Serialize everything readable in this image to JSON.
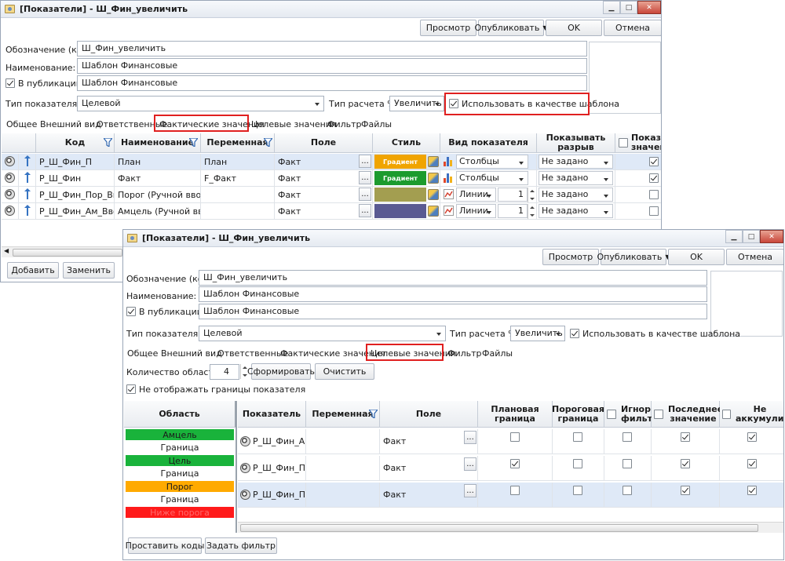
{
  "window1": {
    "title": "[Показатели] - Ш_Фин_увеличить",
    "toolbar": {
      "preview": "Просмотр",
      "publish": "Опубликовать",
      "ok": "OK",
      "cancel": "Отмена"
    },
    "form": {
      "code_label": "Обозначение (код):",
      "code_value": "Ш_Фин_увеличить",
      "name_label": "Наименование:",
      "name_value": "Шаблон Финансовые",
      "pub_label": "В публикации:",
      "pub_value": "Шаблон Финансовые",
      "type_label": "Тип показателя:",
      "type_value": "Целевой",
      "calc_label": "Тип расчета % :",
      "calc_value": "Увеличить",
      "template_label": "Использовать в качестве шаблона"
    },
    "tabs": [
      "Общее",
      "Внешний вид",
      "Ответственные",
      "Фактические значения",
      "Целевые значения",
      "Фильтр",
      "Файлы"
    ],
    "grid": {
      "headers": {
        "code": "Код",
        "name": "Наименование",
        "variable": "Переменная",
        "field": "Поле",
        "style": "Стиль",
        "view": "Вид показателя",
        "gap": "Показывать разрыв",
        "show": "Показы значен"
      },
      "rows": [
        {
          "code": "Р_Ш_Фин_П",
          "name": "План",
          "variable": "План",
          "field": "Факт",
          "style": "Градиент",
          "view": "Столбцы",
          "thickness": "",
          "gap": "Не задано",
          "show": true
        },
        {
          "code": "Р_Ш_Фин",
          "name": "Факт",
          "variable": "F_Факт",
          "field": "Факт",
          "style": "Градиент",
          "view": "Столбцы",
          "thickness": "",
          "gap": "Не задано",
          "show": true
        },
        {
          "code": "Р_Ш_Фин_Пор_Ввод",
          "name": "Порог (Ручной ввод)",
          "variable": "",
          "field": "Факт",
          "style": "",
          "view": "Линии",
          "thickness": "1",
          "gap": "Не задано",
          "show": false
        },
        {
          "code": "Р_Ш_Фин_Ам_Ввод",
          "name": "Амцель (Ручной ввод)",
          "variable": "",
          "field": "Факт",
          "style": "",
          "view": "Линии",
          "thickness": "1",
          "gap": "Не задано",
          "show": false
        }
      ]
    },
    "footer": {
      "add": "Добавить",
      "replace": "Заменить"
    }
  },
  "window2": {
    "title": "[Показатели] - Ш_Фин_увеличить",
    "toolbar": {
      "preview": "Просмотр",
      "publish": "Опубликовать",
      "ok": "OK",
      "cancel": "Отмена"
    },
    "form": {
      "code_label": "Обозначение (код):",
      "code_value": "Ш_Фин_увеличить",
      "name_label": "Наименование:",
      "name_value": "Шаблон Финансовые",
      "pub_label": "В публикации:",
      "pub_value": "Шаблон Финансовые",
      "type_label": "Тип показателя:",
      "type_value": "Целевой",
      "calc_label": "Тип расчета % :",
      "calc_value": "Увеличить",
      "template_label": "Использовать в качестве шаблона"
    },
    "tabs": [
      "Общее",
      "Внешний вид",
      "Ответственные",
      "Фактические значения",
      "Целевые значения",
      "Фильтр",
      "Файлы"
    ],
    "areas_label": "Количество областей:",
    "areas_value": "4",
    "form_btn": "Сформировать",
    "clear_btn": "Очистить",
    "hide_borders": "Не отображать границы показателя",
    "area_header": "Область",
    "areas": [
      {
        "label": "Амцель",
        "color": "#19b33b"
      },
      {
        "label": "Граница",
        "color": "#ffffff"
      },
      {
        "label": "Цель",
        "color": "#19b33b"
      },
      {
        "label": "Граница",
        "color": "#ffffff"
      },
      {
        "label": "Порог",
        "color": "#ffaa00"
      },
      {
        "label": "Граница",
        "color": "#ffffff"
      },
      {
        "label": "Ниже порога",
        "color": "#ff1a1a"
      }
    ],
    "grid": {
      "headers": {
        "indicator": "Показатель",
        "variable": "Переменная",
        "field": "Поле",
        "plan": "Плановая граница",
        "threshold": "Пороговая граница",
        "ignore": "Игнор. фильтр",
        "last": "Последнее значение",
        "noacc": "Не аккумулиро"
      },
      "rows": [
        {
          "indicator": "Р_Ш_Фин_Ам",
          "field": "Факт",
          "plan": false,
          "threshold": false,
          "ignore": false,
          "last": true,
          "noacc": true
        },
        {
          "indicator": "Р_Ш_Фин_П",
          "field": "Факт",
          "plan": true,
          "threshold": false,
          "ignore": false,
          "last": true,
          "noacc": true
        },
        {
          "indicator": "Р_Ш_Фин_Пор",
          "field": "Факт",
          "plan": false,
          "threshold": false,
          "ignore": false,
          "last": true,
          "noacc": true
        }
      ]
    },
    "footer": {
      "set_codes": "Проставить коды",
      "set_filter": "Задать фильтр"
    }
  },
  "colors": {
    "gradient_orange": "#f0a400",
    "gradient_green": "#1c9b2e",
    "olive": "#a39e50",
    "slate": "#5a5a92",
    "highlight": "#e02020"
  }
}
